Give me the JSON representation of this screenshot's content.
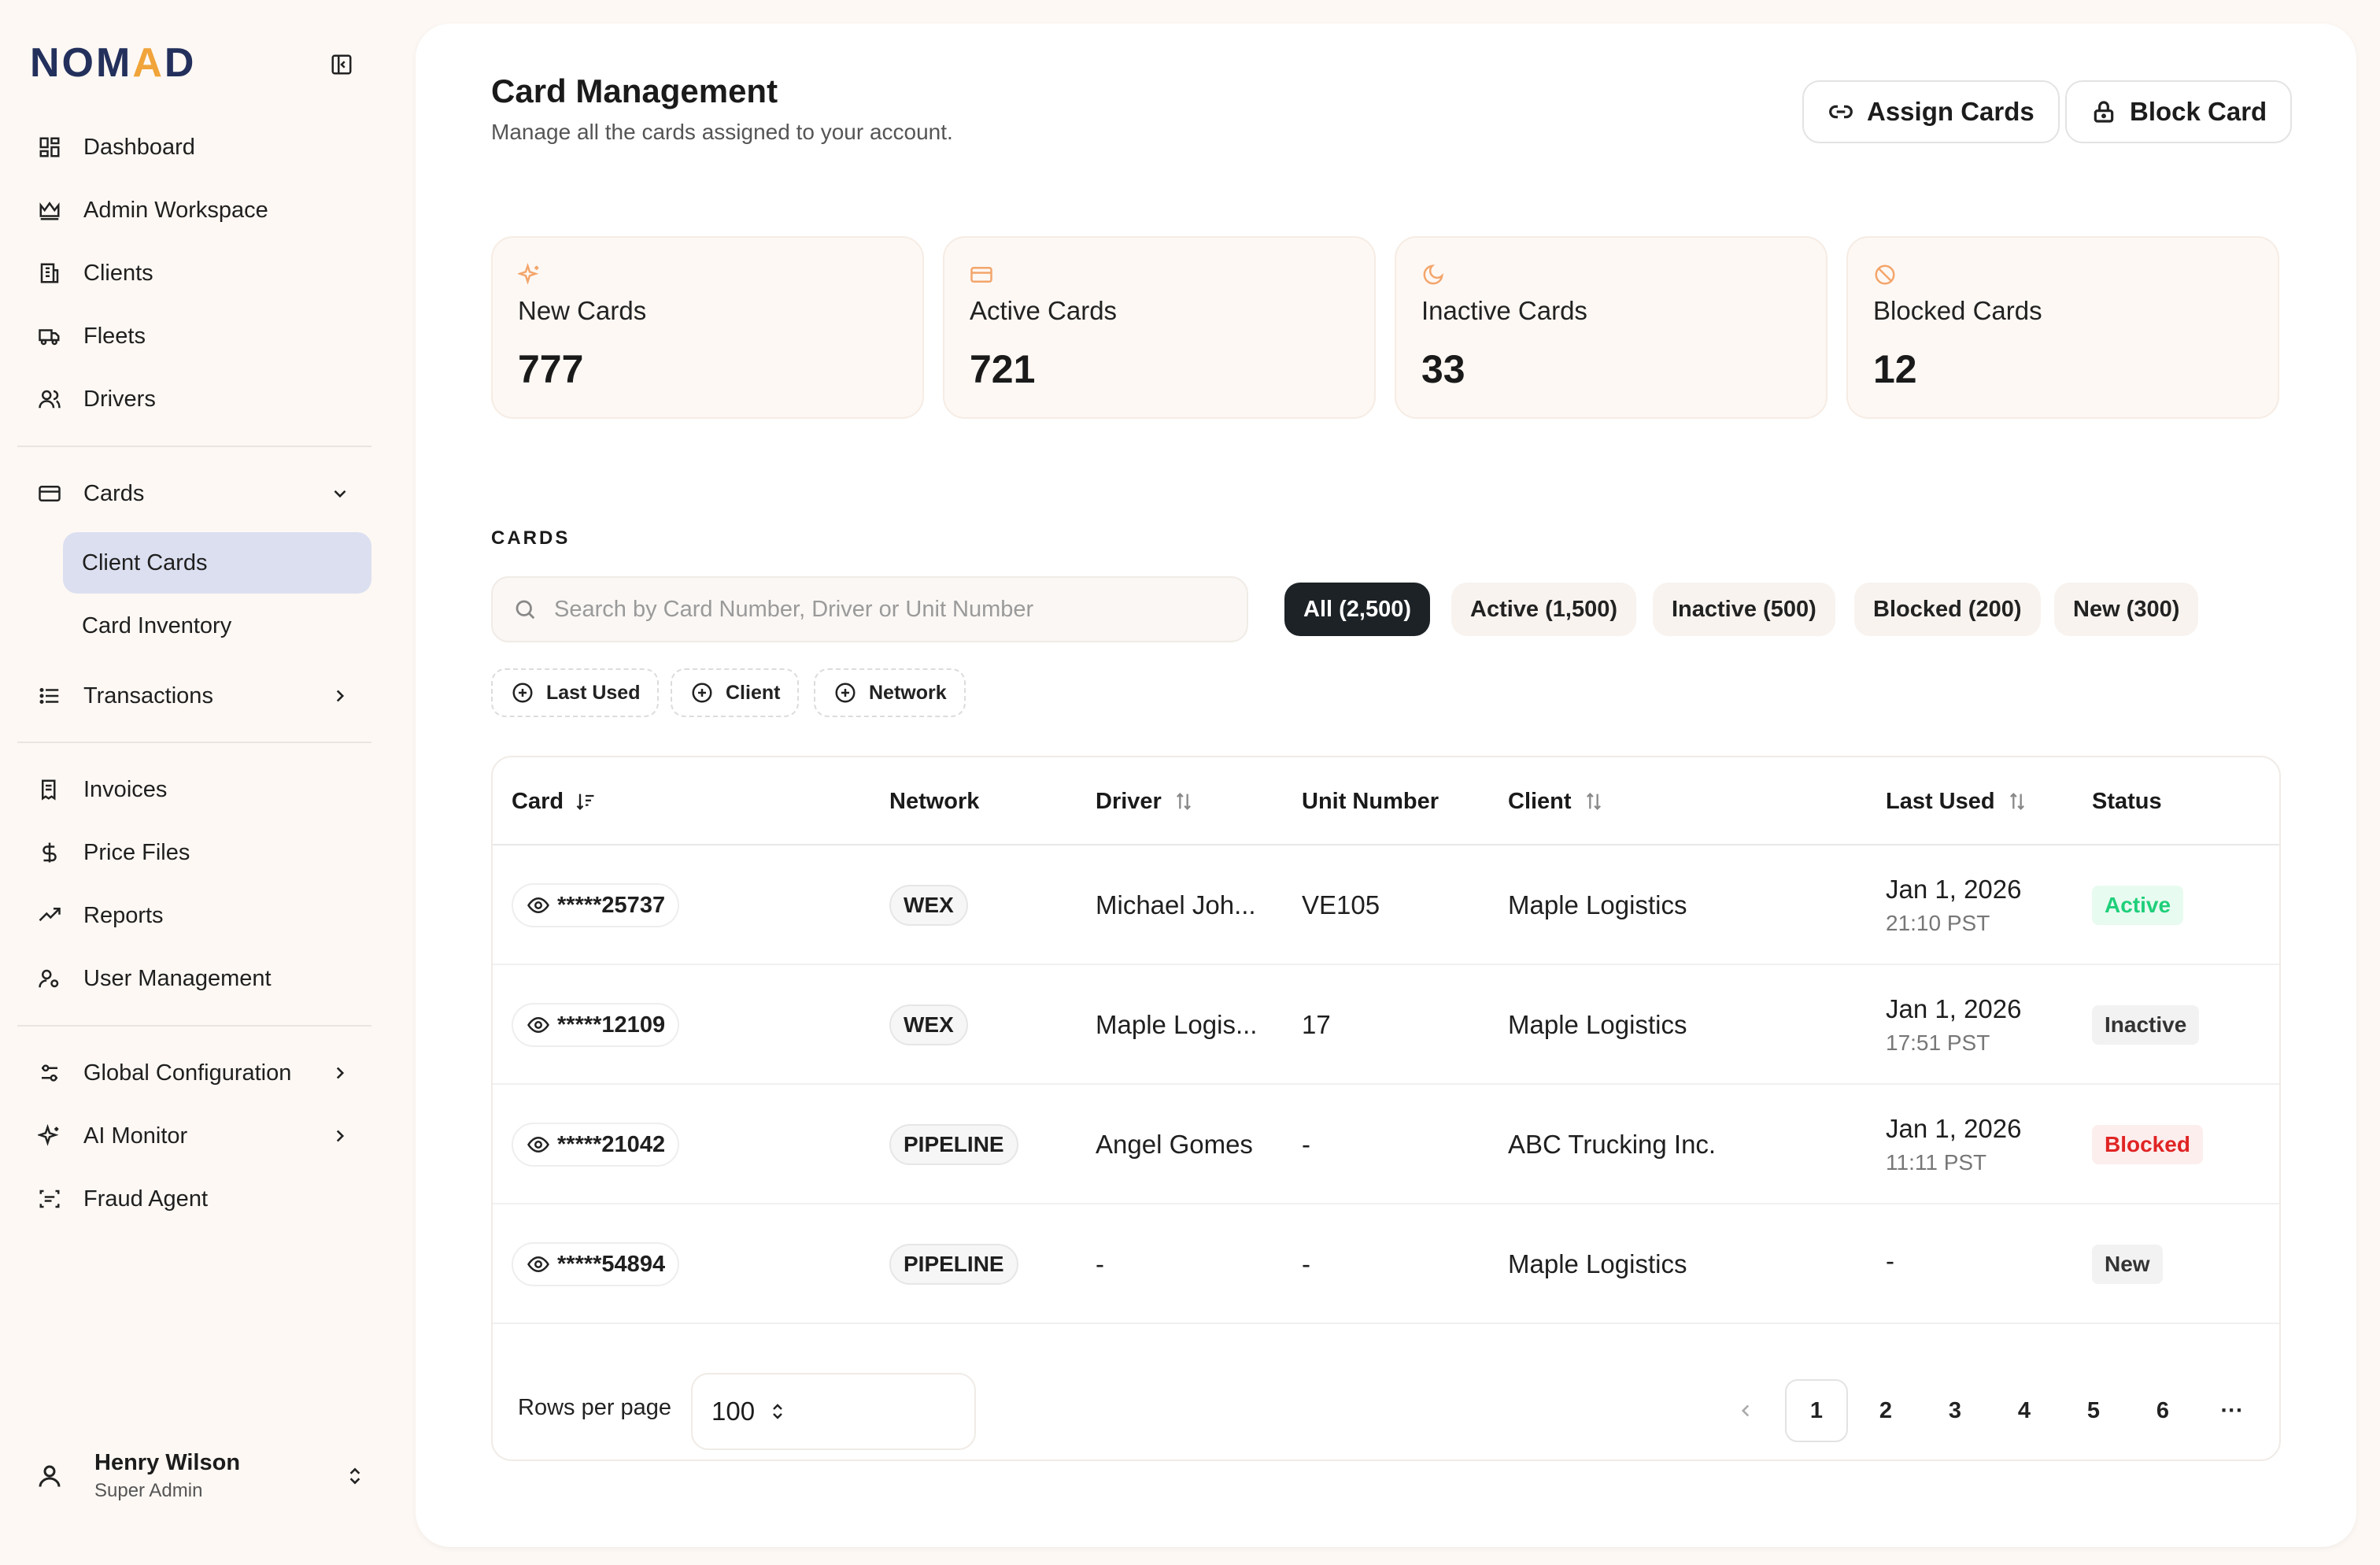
{
  "brand": {
    "prefix": "NOM",
    "accent": "A",
    "suffix": "D"
  },
  "sidebar": {
    "items_top": [
      {
        "label": "Dashboard",
        "icon": "dashboard-icon"
      },
      {
        "label": "Admin Workspace",
        "icon": "crown-icon"
      },
      {
        "label": "Clients",
        "icon": "building-icon"
      },
      {
        "label": "Fleets",
        "icon": "truck-icon"
      },
      {
        "label": "Drivers",
        "icon": "users-icon"
      }
    ],
    "cards": {
      "label": "Cards",
      "sub": [
        "Client Cards",
        "Card Inventory"
      ]
    },
    "transactions": "Transactions",
    "items_mid": [
      "Invoices",
      "Price Files",
      "Reports",
      "User Management"
    ],
    "items_bottom": [
      "Global Configuration",
      "AI Monitor",
      "Fraud Agent"
    ],
    "user": {
      "name": "Henry Wilson",
      "role": "Super Admin"
    }
  },
  "header": {
    "title": "Card Management",
    "subtitle": "Manage all the cards assigned to your account.",
    "assign_label": "Assign Cards",
    "block_label": "Block Card"
  },
  "stats": [
    {
      "label": "New Cards",
      "value": "777",
      "color": "#f3a56b"
    },
    {
      "label": "Active Cards",
      "value": "721",
      "color": "#f3a56b"
    },
    {
      "label": "Inactive Cards",
      "value": "33",
      "color": "#f3a56b"
    },
    {
      "label": "Blocked Cards",
      "value": "12",
      "color": "#f3a56b"
    }
  ],
  "cards_section": {
    "label": "CARDS",
    "search_placeholder": "Search by Card Number, Driver or Unit Number",
    "tabs": [
      "All (2,500)",
      "Active (1,500)",
      "Inactive (500)",
      "Blocked (200)",
      "New (300)"
    ],
    "filters": [
      "Last Used",
      "Client",
      "Network"
    ]
  },
  "table": {
    "headers": [
      "Card",
      "Network",
      "Driver",
      "Unit Number",
      "Client",
      "Last Used",
      "Status"
    ],
    "rows": [
      {
        "card": "*****25737",
        "network": "WEX",
        "driver": "Michael Joh...",
        "unit": "VE105",
        "client": "Maple Logistics",
        "date": "Jan 1, 2026",
        "time": "21:10 PST",
        "status": "Active"
      },
      {
        "card": "*****12109",
        "network": "WEX",
        "driver": "Maple Logis...",
        "unit": "17",
        "client": "Maple Logistics",
        "date": "Jan 1, 2026",
        "time": "17:51 PST",
        "status": "Inactive"
      },
      {
        "card": "*****21042",
        "network": "PIPELINE",
        "driver": "Angel Gomes",
        "unit": "-",
        "client": "ABC Trucking Inc.",
        "date": "Jan 1, 2026",
        "time": "11:11 PST",
        "status": "Blocked"
      },
      {
        "card": "*****54894",
        "network": "PIPELINE",
        "driver": "-",
        "unit": "-",
        "client": "Maple Logistics",
        "date": "-",
        "time": "",
        "status": "New"
      }
    ]
  },
  "pagination": {
    "rows_per_page_label": "Rows per page",
    "rows_per_page": "100",
    "pages": [
      "1",
      "2",
      "3",
      "4",
      "5",
      "6"
    ],
    "ellipsis": "···",
    "current": "1"
  },
  "colors": {
    "accent": "#f0a43a",
    "brand": "#23305c",
    "active_nav": "#dcdff0"
  }
}
